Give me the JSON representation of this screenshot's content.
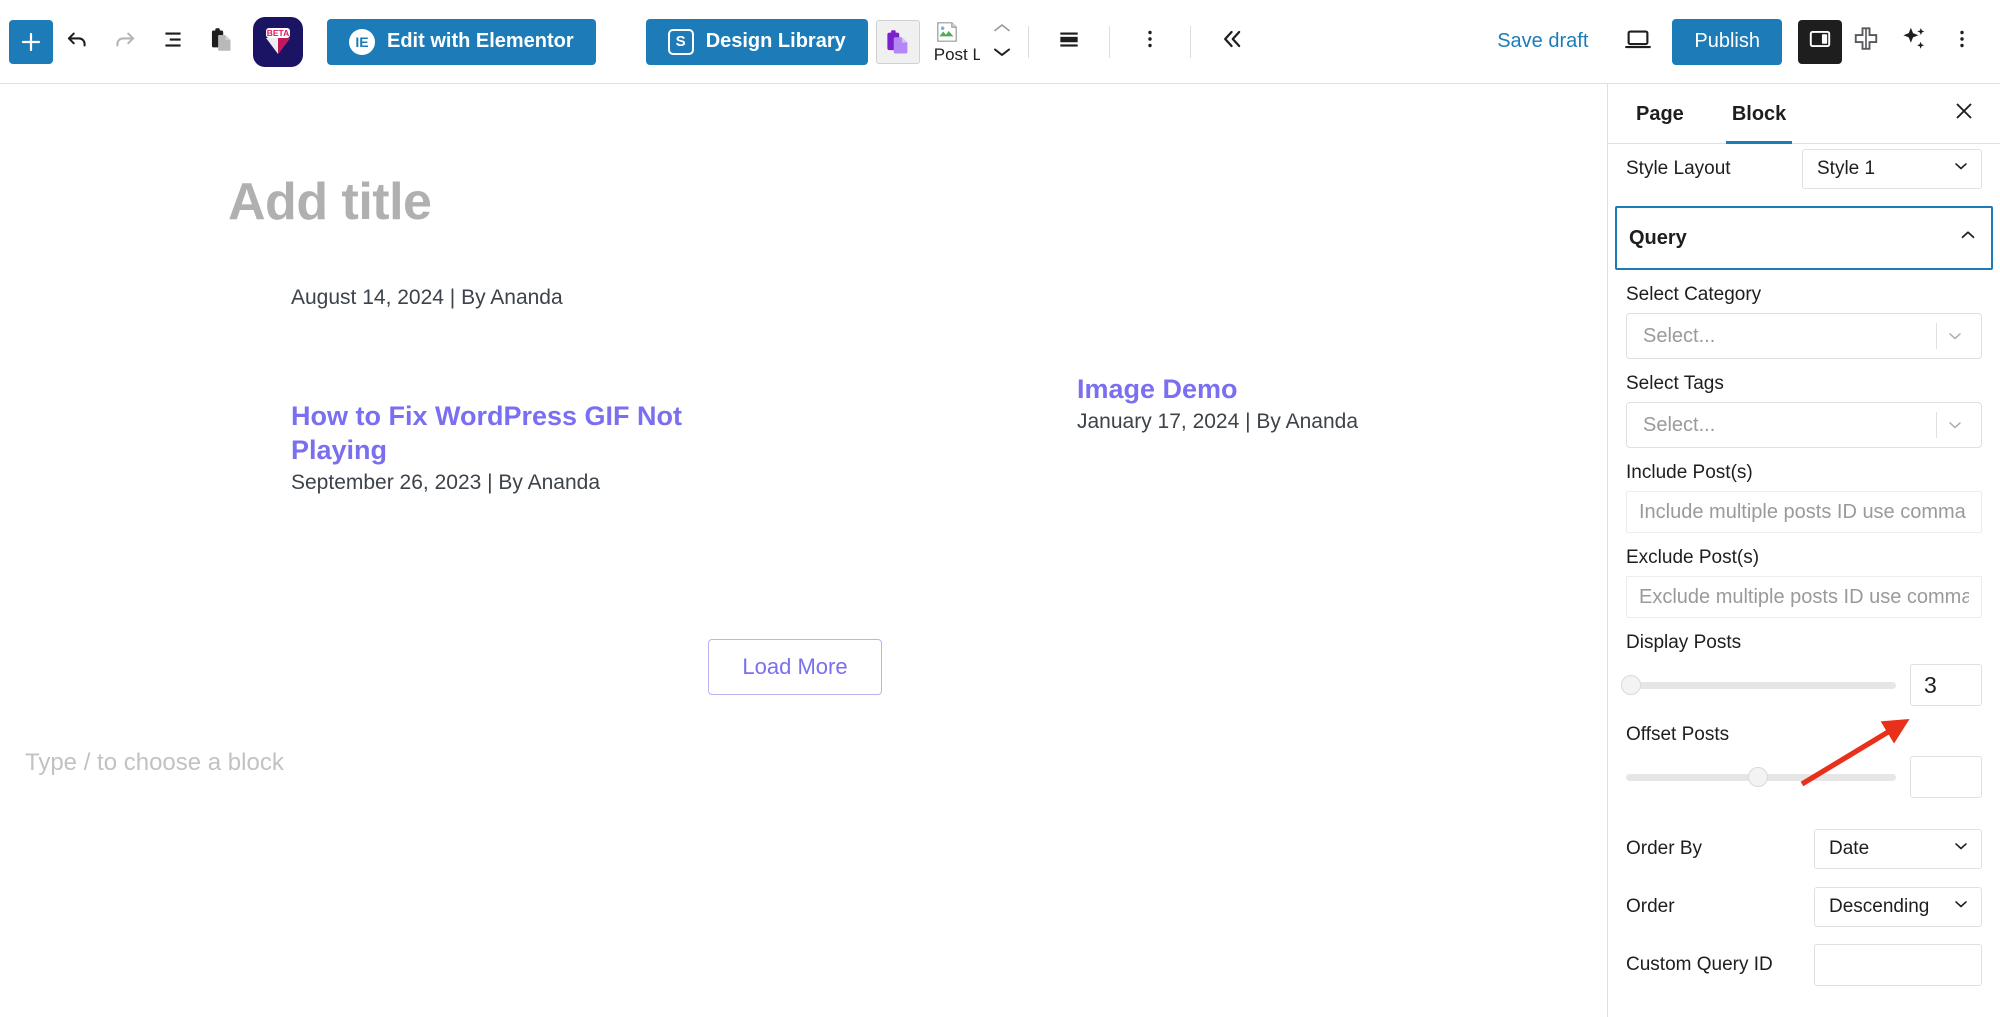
{
  "toolbar": {
    "add_block_icon": "plus-icon",
    "undo_icon": "undo-arrow-icon",
    "redo_icon": "redo-arrow-icon",
    "list_view_icon": "document-outline-icon",
    "copy_icon": "clipboard-copy-icon",
    "beta_app_icon": "beta-plugin-icon",
    "beta_badge": "BETA",
    "elementor_button": "Edit with Elementor",
    "elementor_icon": "elementor-logo-icon",
    "design_library_button": "Design Library",
    "design_library_icon": "stackable-s-icon",
    "copy_plugin_icon": "purple-copy-paste-icon",
    "broken_image_icon": "broken-image-icon",
    "broken_image_label": "Post Listi",
    "stepper_up_icon": "chevron-up-icon",
    "stepper_down_icon": "chevron-down-icon",
    "align_icon": "block-align-icon",
    "more_options_icon": "vertical-ellipsis-icon",
    "collapse_icon": "double-chevron-left-icon",
    "save_draft": "Save draft",
    "preview_icon": "laptop-preview-icon",
    "publish_button": "Publish",
    "settings_toggle_icon": "settings-sidebar-icon",
    "plugin_icon": "jetpack-plus-icon",
    "ai_icon": "sparkles-ai-icon",
    "options_icon": "vertical-ellipsis-icon"
  },
  "canvas": {
    "title_placeholder": "Add title",
    "block_placeholder": "Type / to choose a block",
    "load_more_button": "Load More",
    "posts": [
      {
        "title": "",
        "meta": "August 14, 2024 | By Ananda"
      },
      {
        "title": "How to Fix WordPress GIF Not Playing",
        "meta": "September 26, 2023 | By Ananda"
      },
      {
        "title": "Image Demo",
        "meta": "January 17, 2024 | By Ananda"
      }
    ]
  },
  "sidebar": {
    "tabs": [
      {
        "label": "Page",
        "active": false
      },
      {
        "label": "Block",
        "active": true
      }
    ],
    "close_icon": "close-x-icon",
    "style_layout": {
      "label": "Style Layout",
      "value": "Style 1"
    },
    "query": {
      "heading": "Query",
      "collapse_icon": "chevron-up-icon",
      "select_category": {
        "label": "Select Category",
        "placeholder": "Select..."
      },
      "select_tags": {
        "label": "Select Tags",
        "placeholder": "Select..."
      },
      "include_posts": {
        "label": "Include Post(s)",
        "placeholder": "Include multiple posts ID use comma as separator"
      },
      "exclude_posts": {
        "label": "Exclude Post(s)",
        "placeholder": "Exclude multiple posts ID use comma as separator"
      },
      "display_posts": {
        "label": "Display Posts",
        "value": "3",
        "slider_percent": 2
      },
      "offset_posts": {
        "label": "Offset Posts",
        "value": "",
        "slider_percent": 49
      },
      "order_by": {
        "label": "Order By",
        "value": "Date"
      },
      "order": {
        "label": "Order",
        "value": "Descending"
      },
      "custom_query_id": {
        "label": "Custom Query ID",
        "value": ""
      }
    }
  },
  "annotation": {
    "arrow_icon": "red-arrow-pointing-up-right",
    "color": "#e8301a",
    "target": "Display Posts value box"
  },
  "colors": {
    "accent_blue": "#1d7cb8",
    "link_purple": "#7a6ff0",
    "dark": "#1e1e1e"
  }
}
